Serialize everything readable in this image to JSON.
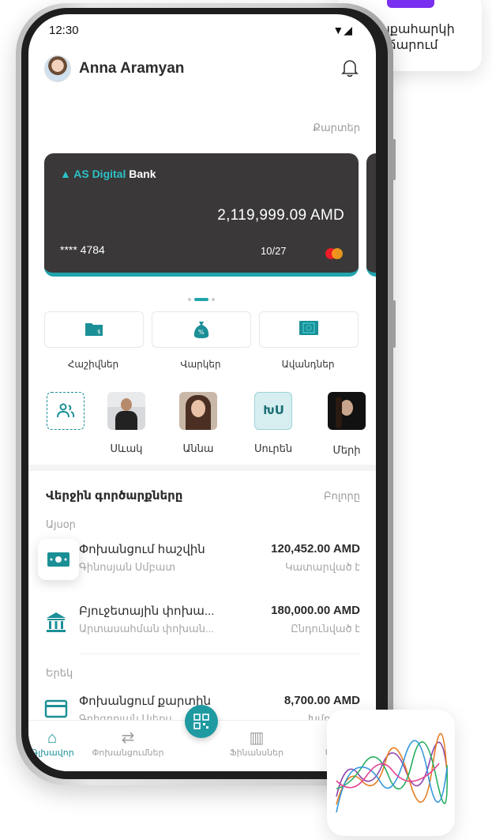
{
  "status": {
    "time": "12:30",
    "signal_icon": "signal-wifi-icon"
  },
  "user": {
    "name": "Anna Aramyan"
  },
  "cards_link": "Քարտեր",
  "card": {
    "bank_prefix": "AS Digital",
    "bank_suffix": "Bank",
    "balance": "2,119,999.09 AMD",
    "number": "**** 4784",
    "expiry": "10/27",
    "accent_color": "#20a4ac"
  },
  "quick_actions": [
    {
      "label": "Հաշիվներ",
      "icon": "wallet-icon"
    },
    {
      "label": "Վարկեր",
      "icon": "money-bag-icon"
    },
    {
      "label": "Ավանդներ",
      "icon": "safe-icon"
    }
  ],
  "contacts": [
    {
      "name": "Սևակ"
    },
    {
      "name": "Աննա"
    },
    {
      "name": "Սուրեն",
      "initials": "ՒՍՍ"
    },
    {
      "name": "Մերի"
    }
  ],
  "recent": {
    "title": "Վերջին գործարքները",
    "all_label": "Բոլորը",
    "groups": [
      {
        "label": "Այսօր",
        "items": [
          {
            "title": "Փոխանցում հաշվին",
            "subtitle": "Գինոսյան Սմբատ",
            "amount": "120,452.00 AMD",
            "status": "Կատարված է"
          },
          {
            "title": "Բյուջետային փոխա...",
            "subtitle": "Արտասահման փոխան...",
            "amount": "180,000.00 AMD",
            "status": "Ընդունված է"
          }
        ]
      },
      {
        "label": "Երեկ",
        "items": [
          {
            "title": "Փոխանցում քարտին",
            "subtitle": "Գրիգորյան Ալեքս",
            "amount": "8,700.00 AMD",
            "status": "Խմբագրվ"
          }
        ]
      }
    ]
  },
  "nav": [
    {
      "label": "Գլխավոր",
      "active": true
    },
    {
      "label": "Փոխանցումներ",
      "active": false
    },
    {
      "label": "Ֆինանսներ",
      "active": false
    },
    {
      "label": "Ա",
      "active": false
    }
  ],
  "floating": {
    "payment_text": "Գույքահարկի վճարում"
  }
}
